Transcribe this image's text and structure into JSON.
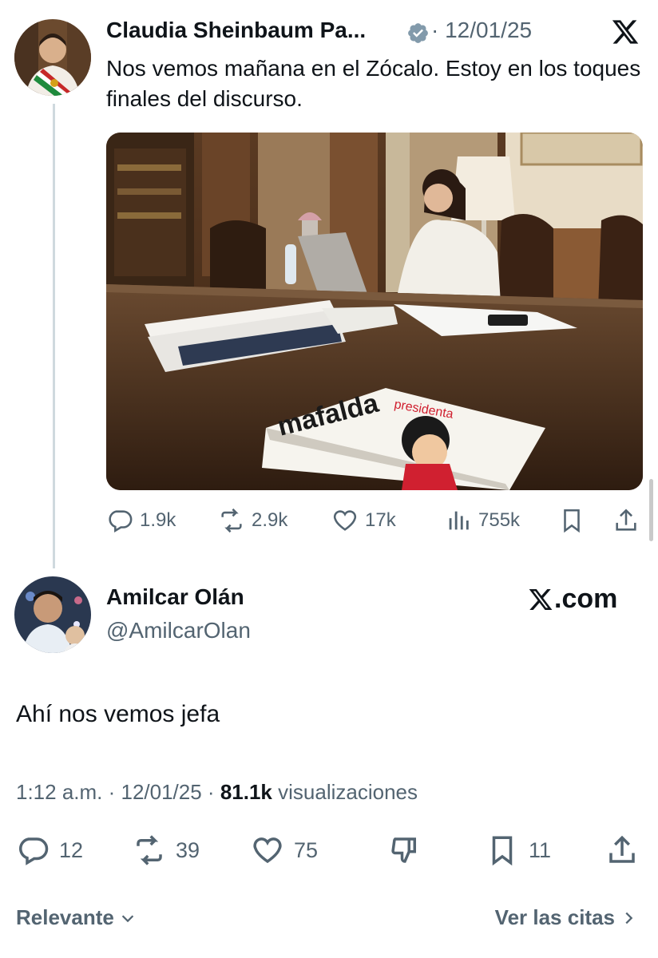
{
  "tweet": {
    "author_name": "Claudia Sheinbaum Pa...",
    "separator_date": "· 12/01/25",
    "text": "Nos vemos mañana en el Zócalo. Estoy en los toques finales del discurso.",
    "book_title": "mafalda",
    "book_subtitle": "presidenta",
    "stats": {
      "replies": "1.9k",
      "reposts": "2.9k",
      "likes": "17k",
      "views": "755k"
    }
  },
  "reply": {
    "author_name": "Amilcar Olán",
    "handle": "@AmilcarOlan",
    "site_label": ".com",
    "text": "Ahí nos vemos jefa",
    "time": "1:12 a.m. · 12/01/25 ·",
    "views_count": "81.1k",
    "views_label": "visualizaciones",
    "stats": {
      "replies": "12",
      "reposts": "39",
      "likes": "75",
      "bookmarks": "11"
    }
  },
  "footer": {
    "sort_label": "Relevante",
    "quotes_link": "Ver las citas"
  },
  "colors": {
    "text": "#0f1419",
    "secondary": "#536471",
    "thread_line": "#cfd9de"
  }
}
